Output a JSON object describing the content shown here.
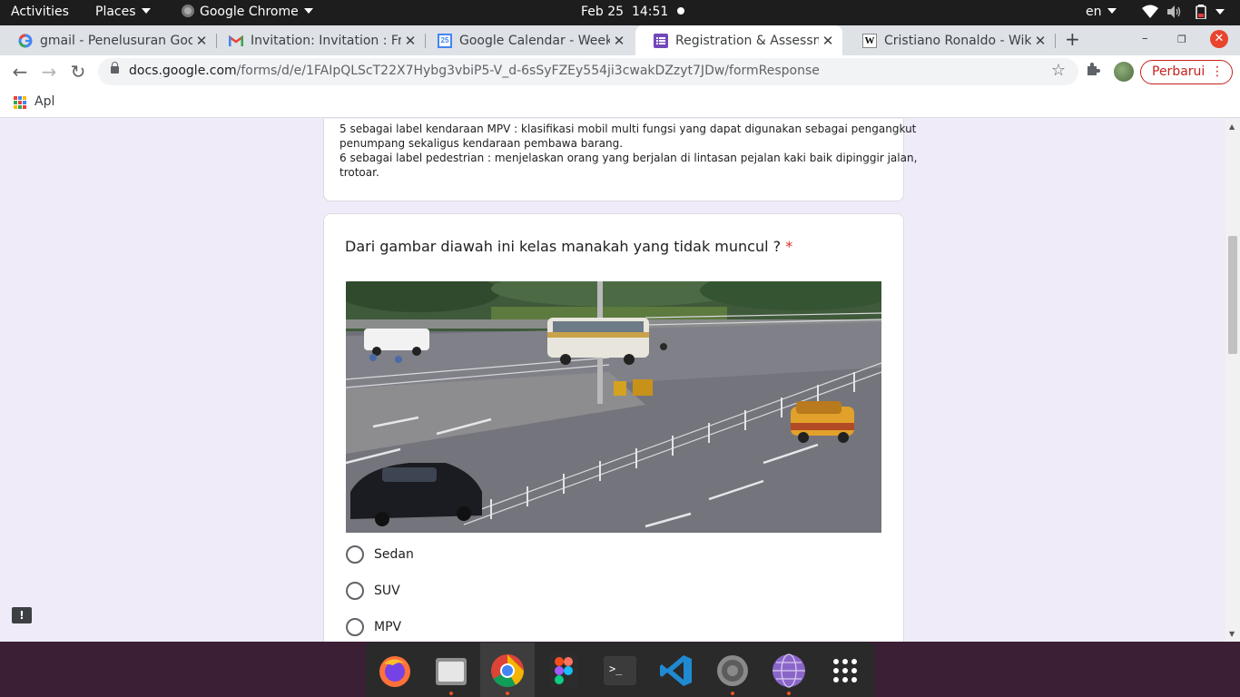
{
  "topbar": {
    "activities": "Activities",
    "places": "Places",
    "app": "Google Chrome",
    "date": "Feb 25",
    "time": "14:51",
    "lang": "en"
  },
  "tabs": [
    {
      "title": "gmail - Penelusuran Goo",
      "icon": "google-icon"
    },
    {
      "title": "Invitation: Invitation : Fr",
      "icon": "gmail-icon"
    },
    {
      "title": "Google Calendar - Week",
      "icon": "calendar-icon",
      "icon_text": "25"
    },
    {
      "title": "Registration & Assessme",
      "icon": "forms-icon"
    },
    {
      "title": "Cristiano Ronaldo - Wikip",
      "icon": "wikipedia-icon",
      "icon_text": "W"
    }
  ],
  "address": {
    "host": "docs.google.com",
    "path": "/forms/d/e/1FAIpQLScT22X7Hybg3vbiP5-V_d-6sSyFZEy554ji3cwakDZzyt7JDw/formResponse"
  },
  "toolbar": {
    "update_label": "Perbarui"
  },
  "bookmarks": {
    "apps_label": "Apl"
  },
  "form": {
    "previous_description": [
      "5 sebagai label kendaraan  MPV : klasifikasi mobil multi fungsi yang dapat digunakan sebagai pengangkut",
      "penumpang sekaligus kendaraan pembawa barang.",
      "6 sebagai label pedestrian : menjelaskan orang yang berjalan di lintasan pejalan kaki baik dipinggir jalan,",
      "trotoar."
    ],
    "question": "Dari gambar diawah ini kelas manakah yang tidak muncul ?",
    "required_mark": "*",
    "options": [
      "Sedan",
      "SUV",
      "MPV"
    ]
  },
  "feedback_label": "!",
  "colors": {
    "form_bg": "#f0ebf8",
    "required": "#d93025",
    "dock_bg": "#2a2a2a",
    "ubuntu_accent": "#e95420"
  },
  "dock": [
    {
      "name": "firefox",
      "running": false
    },
    {
      "name": "files",
      "running": true
    },
    {
      "name": "google-chrome",
      "running": true
    },
    {
      "name": "figma",
      "running": false
    },
    {
      "name": "terminal",
      "running": false
    },
    {
      "name": "visual-studio-code",
      "running": false
    },
    {
      "name": "settings",
      "running": true
    },
    {
      "name": "browser",
      "running": true
    },
    {
      "name": "show-applications",
      "running": false
    }
  ]
}
